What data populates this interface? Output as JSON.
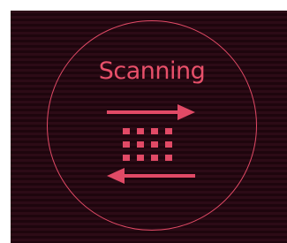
{
  "scanner": {
    "status_label": "Scanning",
    "icon": "scan-direction-icon"
  },
  "colors": {
    "accent": "#e14a66",
    "background": "#2a0a14"
  }
}
